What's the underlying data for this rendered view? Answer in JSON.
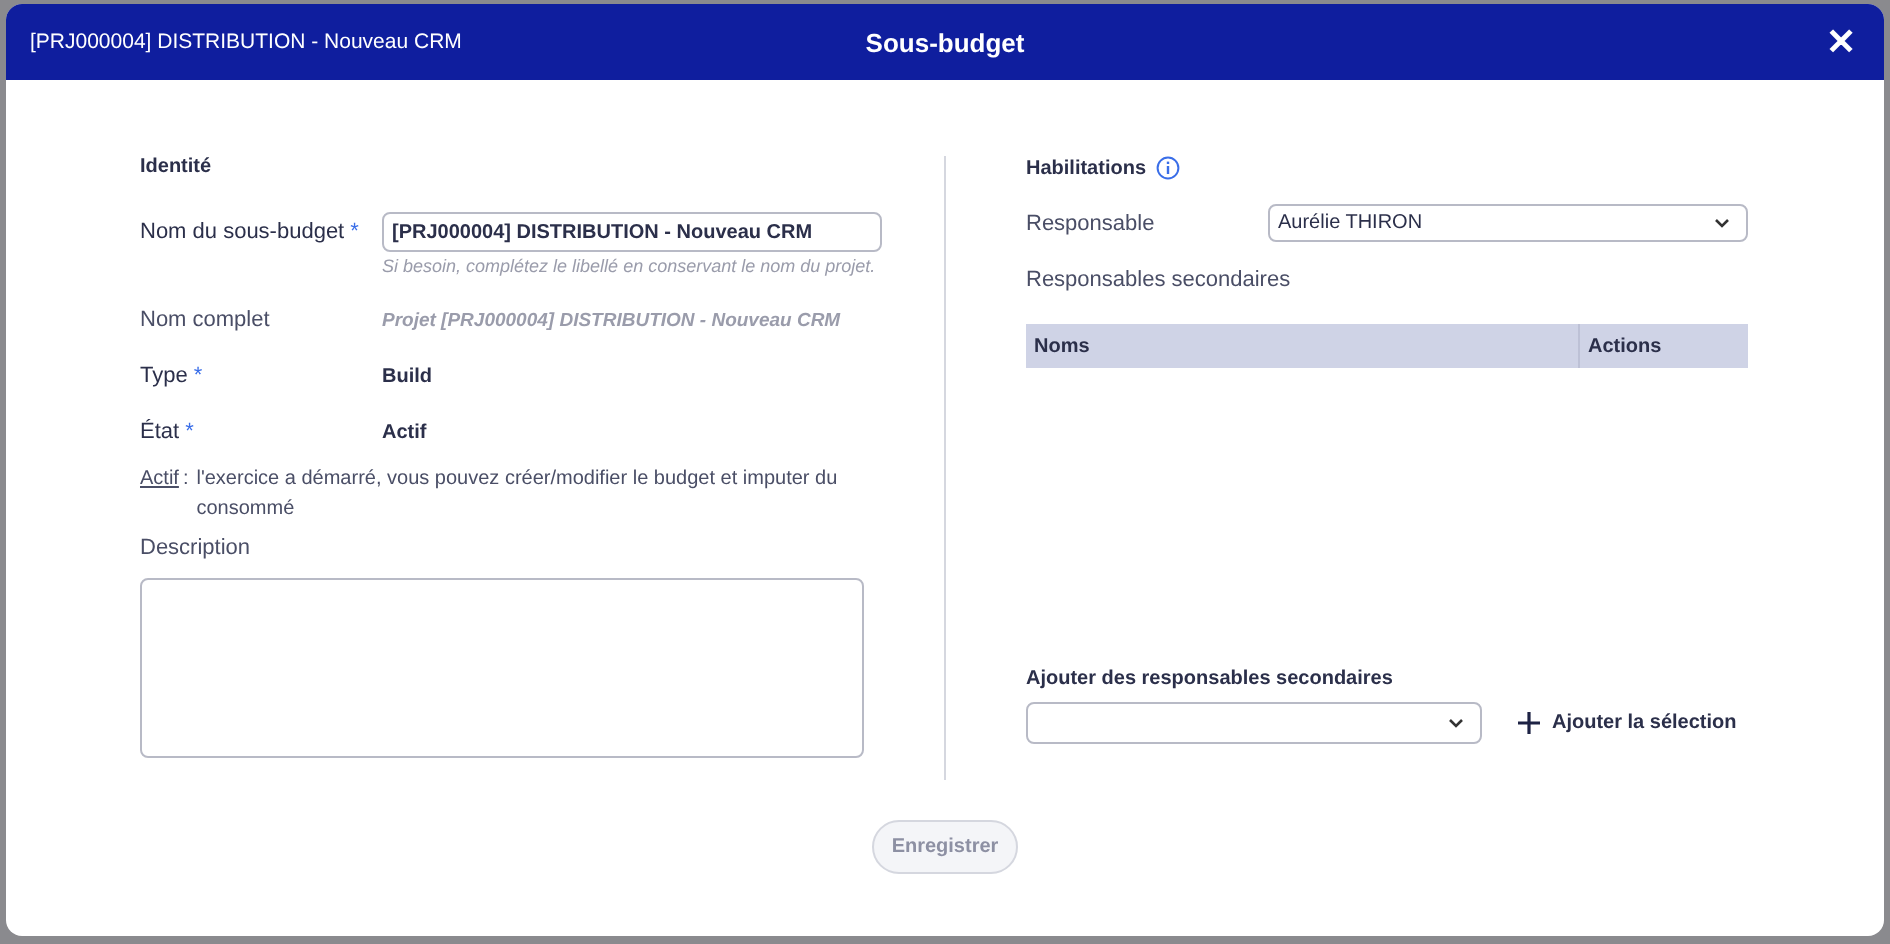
{
  "header": {
    "project": "[PRJ000004] DISTRIBUTION - Nouveau CRM",
    "title": "Sous-budget",
    "close": "✕"
  },
  "identity": {
    "heading": "Identité",
    "name_label": "Nom du sous-budget",
    "name_required": "*",
    "name_value": "[PRJ000004] DISTRIBUTION - Nouveau CRM",
    "name_hint": "Si besoin, complétez le libellé en conservant le nom du projet.",
    "full_label": "Nom complet",
    "full_value": "Projet [PRJ000004] DISTRIBUTION - Nouveau CRM",
    "type_label": "Type",
    "type_required": "*",
    "type_value": "Build",
    "state_label": "État",
    "state_required": "*",
    "state_value": "Actif",
    "state_note_term": "Actif",
    "state_note_sep": ":",
    "state_note": "l'exercice a démarré, vous pouvez créer/modifier le budget et imputer du consommé",
    "description_label": "Description"
  },
  "habilitations": {
    "heading": "Habilitations",
    "owner_label": "Responsable",
    "owner_value": "Aurélie THIRON",
    "secondary_label": "Responsables secondaires",
    "columns": [
      "Noms",
      "Actions"
    ],
    "add_label": "Ajouter des responsables secondaires",
    "add_button": "Ajouter la sélection"
  },
  "save": {
    "label": "Enregistrer",
    "disabled": true
  }
}
